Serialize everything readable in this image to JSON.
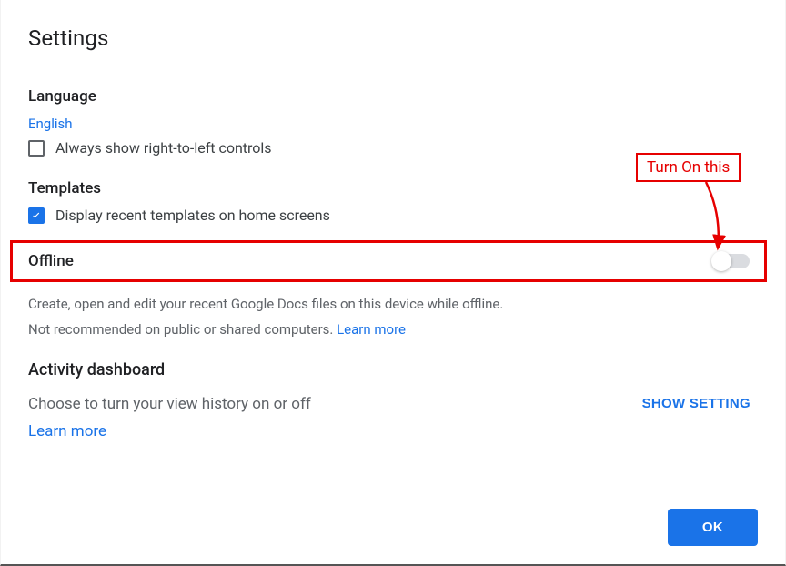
{
  "title": "Settings",
  "language": {
    "heading": "Language",
    "value": "English",
    "rtl_checkbox_label": "Always show right-to-left controls"
  },
  "templates": {
    "heading": "Templates",
    "recent_checkbox_label": "Display recent templates on home screens"
  },
  "offline": {
    "heading": "Offline",
    "description_1": "Create, open and edit your recent Google Docs files on this device while offline.",
    "description_2_prefix": "Not recommended on public or shared computers. ",
    "learn_more": "Learn more"
  },
  "activity": {
    "heading": "Activity dashboard",
    "description": "Choose to turn your view history on or off",
    "show_setting": "SHOW SETTING",
    "learn_more": "Learn more"
  },
  "footer": {
    "ok": "OK"
  },
  "annotation": {
    "label": "Turn On this"
  }
}
